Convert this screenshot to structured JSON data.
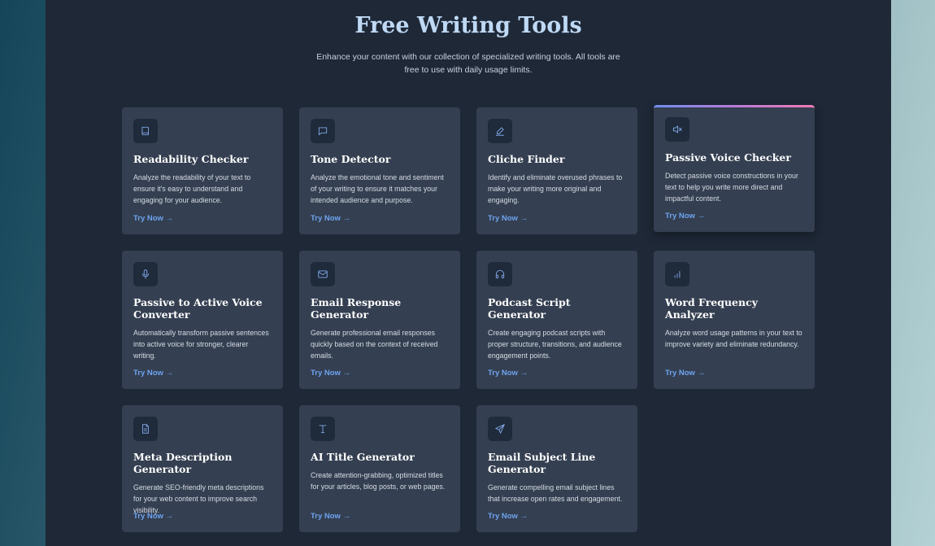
{
  "header": {
    "title": "Free Writing Tools",
    "subtitle": "Enhance your content with our collection of specialized writing tools. All tools are free to use with daily usage limits."
  },
  "colors": {
    "accent": "#6ea4f0",
    "card_bg": "#343f51",
    "panel_bg": "#1e2837"
  },
  "cards": [
    {
      "title": "Readability Checker",
      "desc": "Analyze the readability of your text to ensure it's easy to understand and engaging for your audience.",
      "cta": "Try Now →",
      "icon": "book-icon"
    },
    {
      "title": "Tone Detector",
      "desc": "Analyze the emotional tone and sentiment of your writing to ensure it matches your intended audience and purpose.",
      "cta": "Try Now →",
      "icon": "message-square-icon"
    },
    {
      "title": "Cliche Finder",
      "desc": "Identify and eliminate overused phrases to make your writing more original and engaging.",
      "cta": "Try Now →",
      "icon": "pen-icon"
    },
    {
      "title": "Passive Voice Checker",
      "desc": "Detect passive voice constructions in your text to help you write more direct and impactful content.",
      "cta": "Try Now →",
      "icon": "volume-x-icon"
    },
    {
      "title": "Passive to Active Voice Converter",
      "desc": "Automatically transform passive sentences into active voice for stronger, clearer writing.",
      "cta": "Try Now →",
      "icon": "microphone-icon"
    },
    {
      "title": "Email Response Generator",
      "desc": "Generate professional email responses quickly based on the context of received emails.",
      "cta": "Try Now →",
      "icon": "mail-icon"
    },
    {
      "title": "Podcast Script Generator",
      "desc": "Create engaging podcast scripts with proper structure, transitions, and audience engagement points.",
      "cta": "Try Now →",
      "icon": "headphones-icon"
    },
    {
      "title": "Word Frequency Analyzer",
      "desc": "Analyze word usage patterns in your text to improve variety and eliminate redundancy.",
      "cta": "Try Now →",
      "icon": "bar-chart-icon"
    },
    {
      "title": "Meta Description Generator",
      "desc": "Generate SEO-friendly meta descriptions for your web content to improve search visibility.",
      "cta": "Try Now →",
      "icon": "file-text-icon"
    },
    {
      "title": "AI Title Generator",
      "desc": "Create attention-grabbing, optimized titles for your articles, blog posts, or web pages.",
      "cta": "Try Now →",
      "icon": "type-icon"
    },
    {
      "title": "Email Subject Line Generator",
      "desc": "Generate compelling email subject lines that increase open rates and engagement.",
      "cta": "Try Now →",
      "icon": "send-icon"
    }
  ]
}
